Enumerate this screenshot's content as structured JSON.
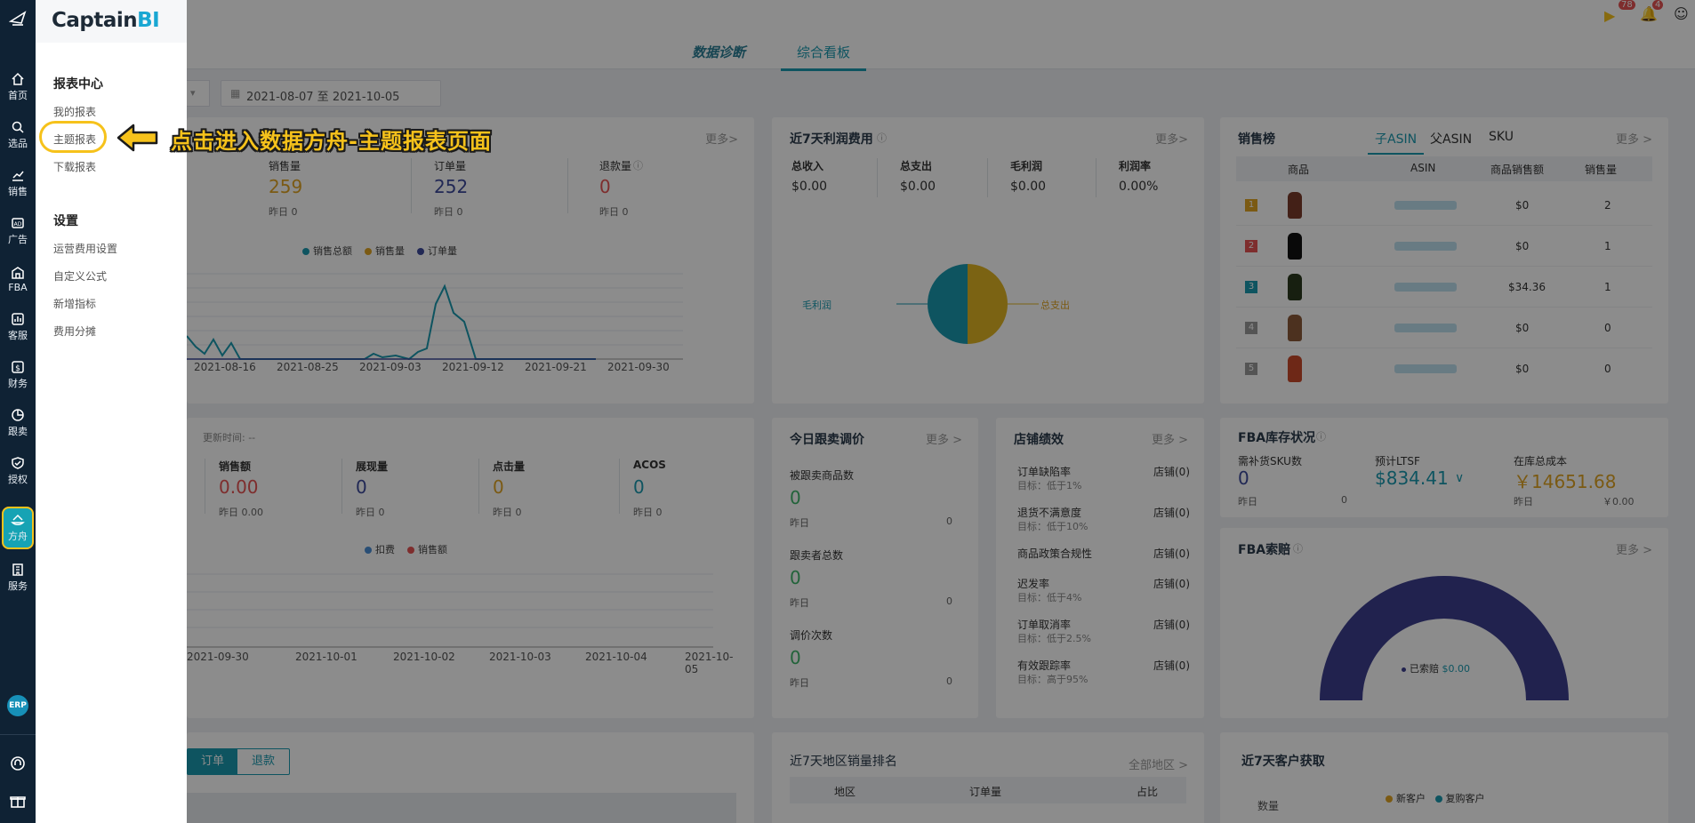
{
  "app": {
    "logo_main": "Captain",
    "logo_accent": "BI"
  },
  "rail": [
    {
      "label": "首页",
      "icon": "home-icon"
    },
    {
      "label": "选品",
      "icon": "search-icon"
    },
    {
      "label": "销售",
      "icon": "chart-line-icon"
    },
    {
      "label": "广告",
      "icon": "ad-icon"
    },
    {
      "label": "FBA",
      "icon": "warehouse-icon"
    },
    {
      "label": "客服",
      "icon": "support-icon"
    },
    {
      "label": "财务",
      "icon": "dollar-icon"
    },
    {
      "label": "跟卖",
      "icon": "pie-icon"
    },
    {
      "label": "授权",
      "icon": "shield-check-icon"
    },
    {
      "label": "方舟",
      "icon": "ark-icon"
    },
    {
      "label": "服务",
      "icon": "building-icon"
    }
  ],
  "rail_erp": "ERP",
  "menu": {
    "group1": "报表中心",
    "my_reports": "我的报表",
    "topic_reports": "主题报表",
    "downloads": "下载报表",
    "group2": "设置",
    "fee_settings": "运营费用设置",
    "custom_formula": "自定义公式",
    "new_metric": "新增指标",
    "fee_split": "费用分摊"
  },
  "callout": "点击进入数据方舟-主题报表页面",
  "header": {
    "badge_flag": "78",
    "badge_bell": "4"
  },
  "tabs": {
    "diagnose": "数据诊断",
    "dashboard": "综合看板"
  },
  "date_range": "2021-08-07 至 2021-10-05",
  "sales_card": {
    "more": "更多>",
    "metrics": [
      {
        "label": "销售量",
        "value": "259",
        "yesterday": "昨日  0",
        "color": "#e0a424"
      },
      {
        "label": "订单量",
        "value": "252",
        "yesterday": "昨日  0",
        "color": "#3c4a9c"
      },
      {
        "label": "退款量",
        "value": "0",
        "yesterday": "昨日  0",
        "color": "#e55353"
      }
    ],
    "legend": [
      "销售总额",
      "销售量",
      "订单量"
    ],
    "xticks": [
      "2021-08-16",
      "2021-08-25",
      "2021-09-03",
      "2021-09-12",
      "2021-09-21",
      "2021-09-30"
    ]
  },
  "profit_card": {
    "title": "近7天利润费用",
    "more": "更多>",
    "cols": [
      {
        "label": "总收入",
        "value": "$0.00"
      },
      {
        "label": "总支出",
        "value": "$0.00"
      },
      {
        "label": "毛利润",
        "value": "$0.00"
      },
      {
        "label": "利润率",
        "value": "0.00%"
      }
    ],
    "pie_left": "毛利润",
    "pie_right": "总支出"
  },
  "ranking_card": {
    "title": "销售榜",
    "tabs": [
      "子ASIN",
      "父ASIN",
      "SKU"
    ],
    "more": "更多 >",
    "headers": [
      "商品",
      "ASIN",
      "商品销售额",
      "销售量"
    ],
    "rows": [
      {
        "rank": "1",
        "sales": "$0",
        "qty": "2"
      },
      {
        "rank": "2",
        "sales": "$0",
        "qty": "1"
      },
      {
        "rank": "3",
        "sales": "$34.36",
        "qty": "1"
      },
      {
        "rank": "4",
        "sales": "$0",
        "qty": "0"
      },
      {
        "rank": "5",
        "sales": "$0",
        "qty": "0"
      }
    ]
  },
  "ads_card": {
    "updated": "更新时间: --",
    "metrics": [
      {
        "label": "销售额",
        "value": "0.00",
        "yesterday": "昨日  0.00",
        "color": "#e55353"
      },
      {
        "label": "展现量",
        "value": "0",
        "yesterday": "昨日  0",
        "color": "#3c4a9c"
      },
      {
        "label": "点击量",
        "value": "0",
        "yesterday": "昨日  0",
        "color": "#e0a424"
      },
      {
        "label": "ACOS",
        "value": "0",
        "yesterday": "昨日  0",
        "color": "#1b9ab0"
      }
    ],
    "legend": [
      "扣费",
      "销售额"
    ],
    "xticks": [
      "2021-09-30",
      "2021-10-01",
      "2021-10-02",
      "2021-10-03",
      "2021-10-04",
      "2021-10-05"
    ]
  },
  "follow_card": {
    "title": "今日跟卖调价",
    "more": "更多 >",
    "items": [
      {
        "label": "被跟卖商品数",
        "value": "0",
        "yesterday_label": "昨日",
        "yesterday": "0"
      },
      {
        "label": "跟卖者总数",
        "value": "0",
        "yesterday_label": "昨日",
        "yesterday": "0"
      },
      {
        "label": "调价次数",
        "value": "0",
        "yesterday_label": "昨日",
        "yesterday": "0"
      }
    ]
  },
  "store_card": {
    "title": "店铺绩效",
    "more": "更多 >",
    "items": [
      {
        "label": "订单缺陷率",
        "target": "目标：低于1%",
        "value": "店铺(0)"
      },
      {
        "label": "退货不满意度",
        "target": "目标：低于10%",
        "value": "店铺(0)"
      },
      {
        "label": "商品政策合规性",
        "target": "",
        "value": "店铺(0)"
      },
      {
        "label": "迟发率",
        "target": "目标：低于4%",
        "value": "店铺(0)"
      },
      {
        "label": "订单取消率",
        "target": "目标：低于2.5%",
        "value": "店铺(0)"
      },
      {
        "label": "有效跟踪率",
        "target": "目标：高于95%",
        "value": "店铺(0)"
      }
    ]
  },
  "fba_stock": {
    "title": "FBA库存状况",
    "cols": [
      {
        "label": "需补货SKU数",
        "value": "0",
        "color": "#3c4a9c"
      },
      {
        "label": "预计LTSF",
        "value": "$834.41",
        "color": "#1b9ab0"
      },
      {
        "label": "在库总成本",
        "value": "￥14651.68",
        "color": "#e0a424"
      }
    ],
    "yesterday_label": "昨日",
    "yesterday1": "0",
    "yesterday2": "￥0.00"
  },
  "fba_claim": {
    "title": "FBA索赔",
    "more": "更多 >",
    "legend_label": "已索赔",
    "legend_value": "$0.00"
  },
  "bottom": {
    "order_btn": "订单",
    "refund_btn": "退款",
    "region_title": "近7天地区销量排名",
    "region_more": "全部地区 >",
    "region_headers": [
      "地区",
      "订单量",
      "占比"
    ],
    "customer_title": "近7天客户获取",
    "customer_legend": [
      "新客户",
      "复购客户"
    ],
    "customer_ylabel": "数量"
  }
}
